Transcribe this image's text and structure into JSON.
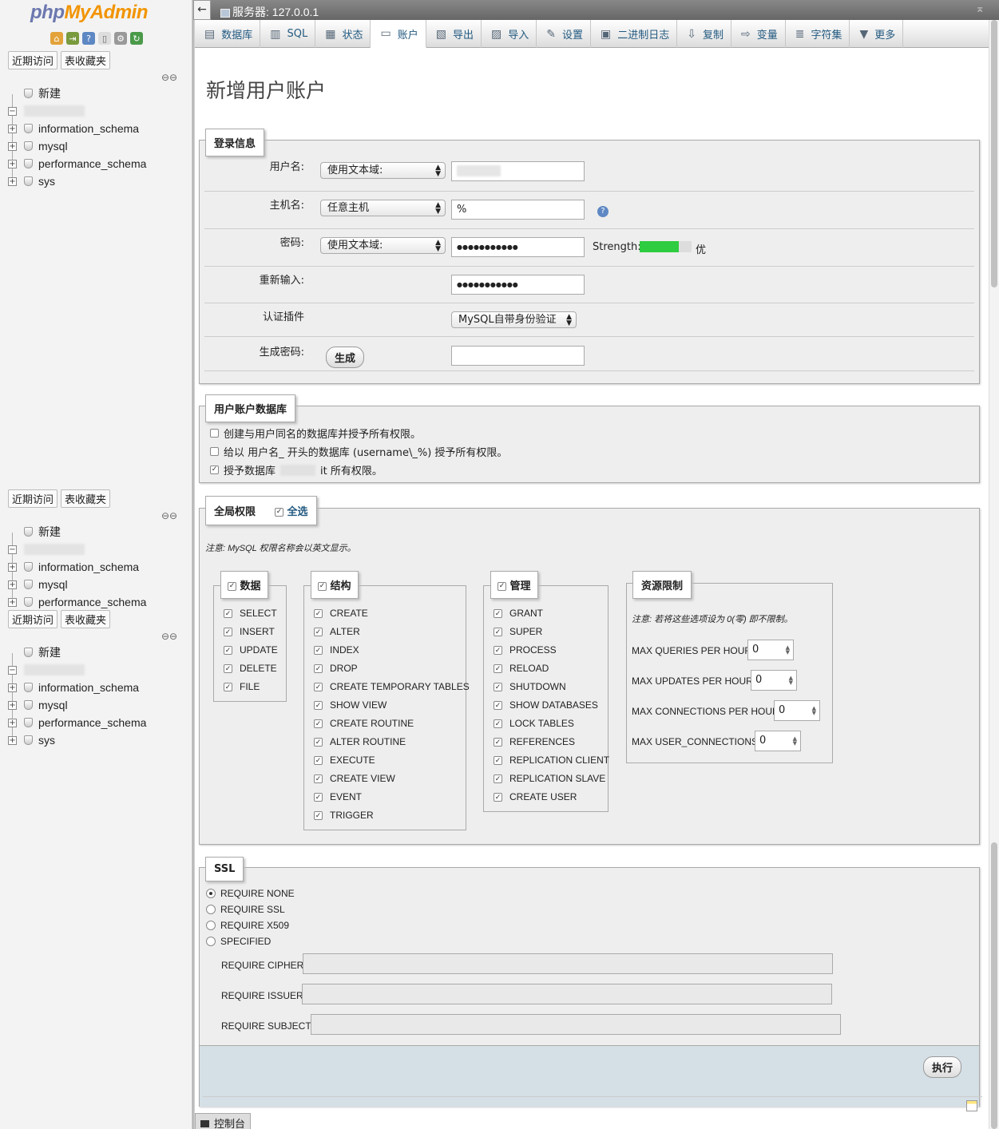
{
  "sidebar": {
    "logo_php": "php",
    "logo_myadmin": "MyAdmin",
    "recent_tab": "近期访问",
    "favorites_tab": "表收藏夹",
    "new_label": "新建",
    "databases": [
      "information_schema",
      "mysql",
      "performance_schema",
      "sys"
    ]
  },
  "topbar": {
    "server": "服务器: 127.0.0.1",
    "back": "←",
    "collapse": "⌅"
  },
  "tabs": [
    {
      "label": "数据库",
      "icon": "▤"
    },
    {
      "label": "SQL",
      "icon": "▥"
    },
    {
      "label": "状态",
      "icon": "▦"
    },
    {
      "label": "账户",
      "icon": "▭"
    },
    {
      "label": "导出",
      "icon": "▧"
    },
    {
      "label": "导入",
      "icon": "▨"
    },
    {
      "label": "设置",
      "icon": "✎"
    },
    {
      "label": "二进制日志",
      "icon": "▣"
    },
    {
      "label": "复制",
      "icon": "⇩"
    },
    {
      "label": "变量",
      "icon": "⇨"
    },
    {
      "label": "字符集",
      "icon": "≣"
    },
    {
      "label": "更多",
      "icon": "▼"
    }
  ],
  "page_title": "新增用户账户",
  "login": {
    "legend": "登录信息",
    "username_label": "用户名:",
    "username_select": "使用文本域:",
    "host_label": "主机名:",
    "host_select": "任意主机",
    "host_value": "%",
    "password_label": "密码:",
    "password_select": "使用文本域:",
    "password_value": "●●●●●●●●●●●",
    "strength_label": "Strength:",
    "strength_level": 0.75,
    "strength_text": "优",
    "reenter_label": "重新输入:",
    "reenter_value": "●●●●●●●●●●●",
    "auth_label": "认证插件",
    "auth_select": "MySQL自带身份验证",
    "generate_label": "生成密码:",
    "generate_button": "生成"
  },
  "userdb": {
    "legend": "用户账户数据库",
    "opt1": "创建与用户同名的数据库并授予所有权限。",
    "opt2": "给以 用户名_ 开头的数据库 (username\\_%) 授予所有权限。",
    "opt3_prefix": "授予数据库",
    "opt3_suffix": "it 所有权限。"
  },
  "global": {
    "legend": "全局权限",
    "select_all": "全选",
    "note": "注意: MySQL 权限名称会以英文显示。",
    "data_legend": "数据",
    "data": [
      "SELECT",
      "INSERT",
      "UPDATE",
      "DELETE",
      "FILE"
    ],
    "structure_legend": "结构",
    "structure": [
      "CREATE",
      "ALTER",
      "INDEX",
      "DROP",
      "CREATE TEMPORARY TABLES",
      "SHOW VIEW",
      "CREATE ROUTINE",
      "ALTER ROUTINE",
      "EXECUTE",
      "CREATE VIEW",
      "EVENT",
      "TRIGGER"
    ],
    "admin_legend": "管理",
    "admin": [
      "GRANT",
      "SUPER",
      "PROCESS",
      "RELOAD",
      "SHUTDOWN",
      "SHOW DATABASES",
      "LOCK TABLES",
      "REFERENCES",
      "REPLICATION CLIENT",
      "REPLICATION SLAVE",
      "CREATE USER"
    ],
    "resource_legend": "资源限制",
    "resource_note": "注意: 若将这些选项设为 0(零) 即不限制。",
    "limits": [
      {
        "label": "MAX QUERIES PER HOUR",
        "value": "0"
      },
      {
        "label": "MAX UPDATES PER HOUR",
        "value": "0"
      },
      {
        "label": "MAX CONNECTIONS PER HOUR",
        "value": "0"
      },
      {
        "label": "MAX USER_CONNECTIONS",
        "value": "0"
      }
    ]
  },
  "ssl": {
    "legend": "SSL",
    "options": [
      "REQUIRE NONE",
      "REQUIRE SSL",
      "REQUIRE X509",
      "SPECIFIED"
    ],
    "cipher_label": "REQUIRE CIPHER",
    "issuer_label": "REQUIRE ISSUER",
    "subject_label": "REQUIRE SUBJECT"
  },
  "go_button": "执行",
  "console_label": "控制台",
  "colors": {
    "strength": "#2ecc40",
    "link": "#235a81",
    "logo_php": "#6c78af",
    "logo_myadmin": "#f29400"
  }
}
